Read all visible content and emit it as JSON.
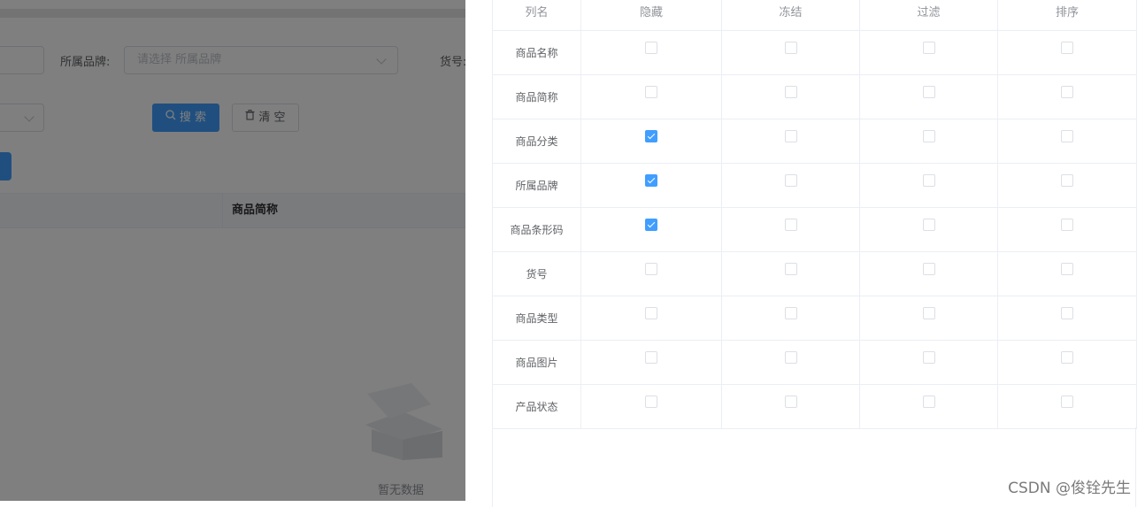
{
  "background": {
    "brand_label": "所属品牌:",
    "brand_placeholder": "请选择 所属品牌",
    "item_no_label": "货号:",
    "search_button": "搜 索",
    "clear_button": "清 空",
    "table_header_col": "商品简称",
    "empty_text": "暂无数据"
  },
  "drawer": {
    "headers": [
      "列名",
      "隐藏",
      "冻结",
      "过滤",
      "排序"
    ],
    "rows": [
      {
        "name": "商品名称",
        "hide": false,
        "freeze": false,
        "filter": false,
        "sort": false
      },
      {
        "name": "商品简称",
        "hide": false,
        "freeze": false,
        "filter": false,
        "sort": false
      },
      {
        "name": "商品分类",
        "hide": true,
        "freeze": false,
        "filter": false,
        "sort": false
      },
      {
        "name": "所属品牌",
        "hide": true,
        "freeze": false,
        "filter": false,
        "sort": false
      },
      {
        "name": "商品条形码",
        "hide": true,
        "freeze": false,
        "filter": false,
        "sort": false
      },
      {
        "name": "货号",
        "hide": false,
        "freeze": false,
        "filter": false,
        "sort": false
      },
      {
        "name": "商品类型",
        "hide": false,
        "freeze": false,
        "filter": false,
        "sort": false
      },
      {
        "name": "商品图片",
        "hide": false,
        "freeze": false,
        "filter": false,
        "sort": false
      },
      {
        "name": "产品状态",
        "hide": false,
        "freeze": false,
        "filter": false,
        "sort": false
      }
    ]
  },
  "watermark": "CSDN @俊铨先生",
  "colors": {
    "primary": "#409eff",
    "mask": "rgba(0,0,0,0.5)",
    "border": "#ebeef5"
  }
}
